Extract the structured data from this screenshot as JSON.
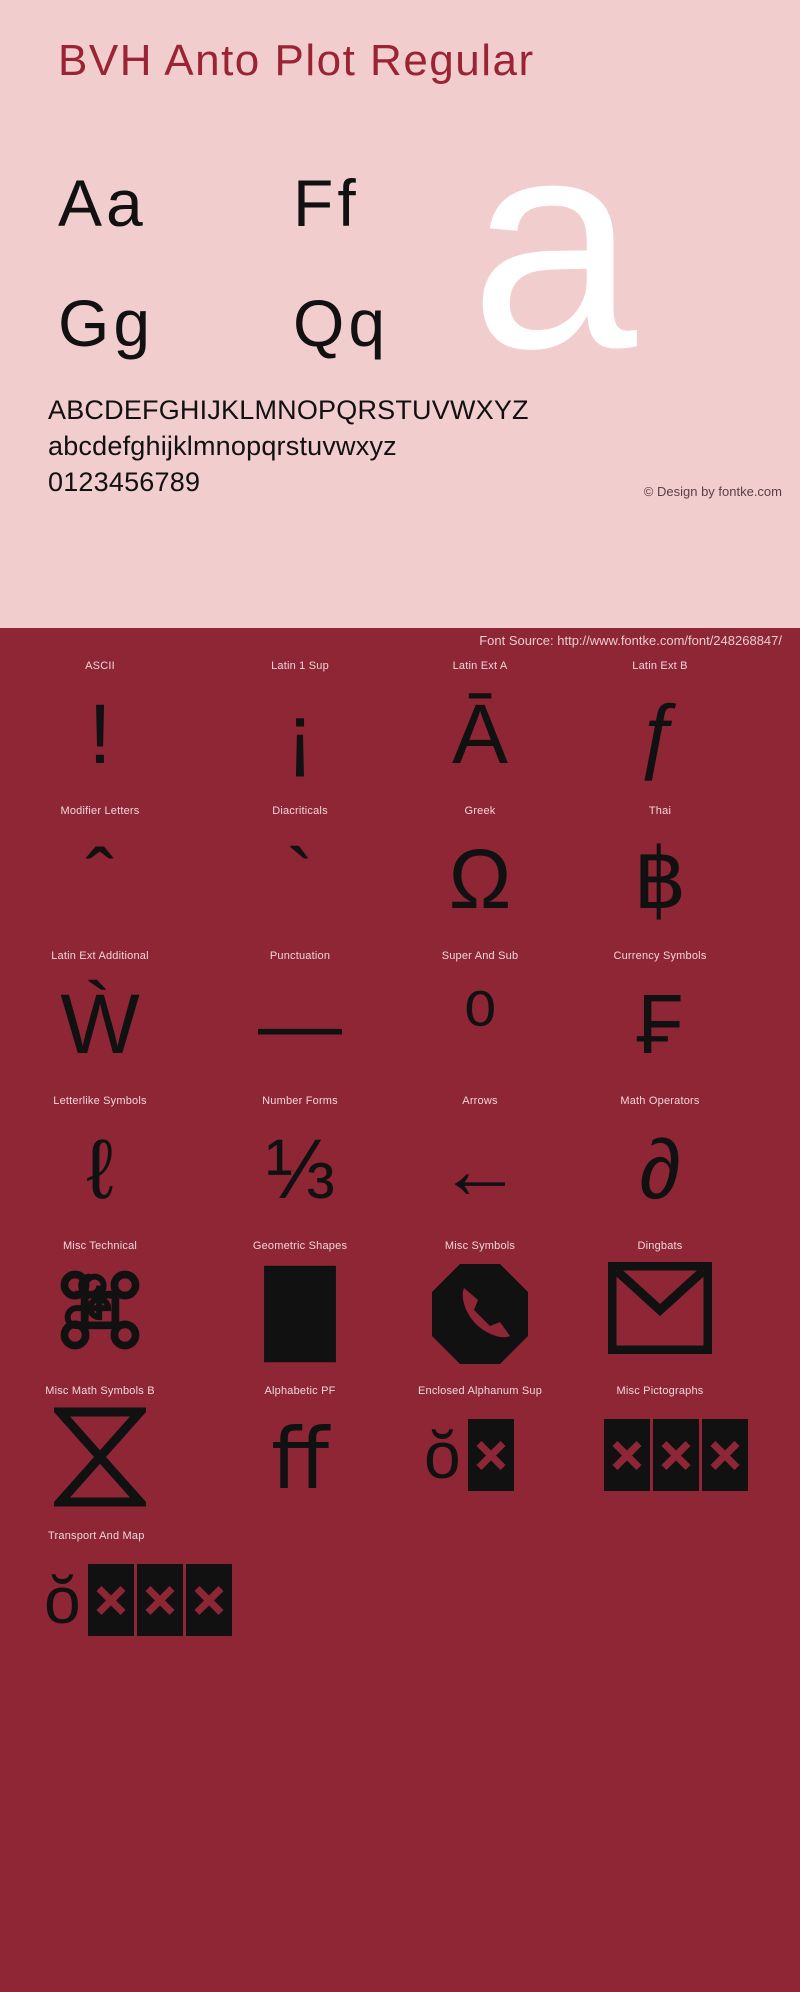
{
  "colors": {
    "pink_bg": "#f2cdcd",
    "dark_red_bg": "#8e2636",
    "title_red": "#9a2435",
    "glyph_black": "#111111",
    "hero_white": "#ffffff",
    "label_pink": "#f0d6da"
  },
  "header": {
    "title": "BVH Anto Plot Regular"
  },
  "samples": {
    "pairs": [
      "Aa",
      "Ff",
      "Gg",
      "Qq"
    ],
    "hero_glyph": "a"
  },
  "alphabet": {
    "uppercase": "ABCDEFGHIJKLMNOPQRSTUVWXYZ",
    "lowercase": "abcdefghijklmnopqrstuvwxyz",
    "digits": "0123456789"
  },
  "credit": {
    "design": "© Design by fontke.com",
    "source": "Font Source: http://www.fontke.com/font/248268847/"
  },
  "blocks": [
    [
      {
        "label": "ASCII",
        "glyph": "!"
      },
      {
        "label": "Latin 1 Sup",
        "glyph": "¡"
      },
      {
        "label": "Latin Ext A",
        "glyph": "Ā"
      },
      {
        "label": "Latin Ext B",
        "glyph": "ƒ"
      }
    ],
    [
      {
        "label": "Modifier Letters",
        "glyph": "ˆ"
      },
      {
        "label": "Diacriticals",
        "glyph": "`"
      },
      {
        "label": "Greek",
        "glyph": "Ω"
      },
      {
        "label": "Thai",
        "glyph": "฿"
      }
    ],
    [
      {
        "label": "Latin Ext Additional",
        "glyph": "Ẁ"
      },
      {
        "label": "Punctuation",
        "glyph": "—"
      },
      {
        "label": "Super And Sub",
        "glyph": "⁰"
      },
      {
        "label": "Currency Symbols",
        "glyph": "₣"
      }
    ],
    [
      {
        "label": "Letterlike Symbols",
        "glyph": "ℓ"
      },
      {
        "label": "Number Forms",
        "glyph": "⅓"
      },
      {
        "label": "Arrows",
        "glyph": "←"
      },
      {
        "label": "Math Operators",
        "glyph": "∂"
      }
    ],
    [
      {
        "label": "Misc Technical",
        "glyph": "⌘"
      },
      {
        "label": "Geometric Shapes",
        "glyph": "■"
      },
      {
        "label": "Misc Symbols",
        "glyph": "✆"
      },
      {
        "label": "Dingbats",
        "glyph": "✉"
      }
    ],
    [
      {
        "label": "Misc Math Symbols B",
        "glyph": "⧖"
      },
      {
        "label": "Alphabetic PF",
        "glyph": "ﬀ"
      },
      {
        "label": "Enclosed Alphanum Sup",
        "glyph": "🅐"
      },
      {
        "label": "Misc Pictographs",
        "glyph": "🌀"
      }
    ],
    [
      {
        "label": "Transport And Map",
        "glyph": "🚀"
      }
    ]
  ]
}
